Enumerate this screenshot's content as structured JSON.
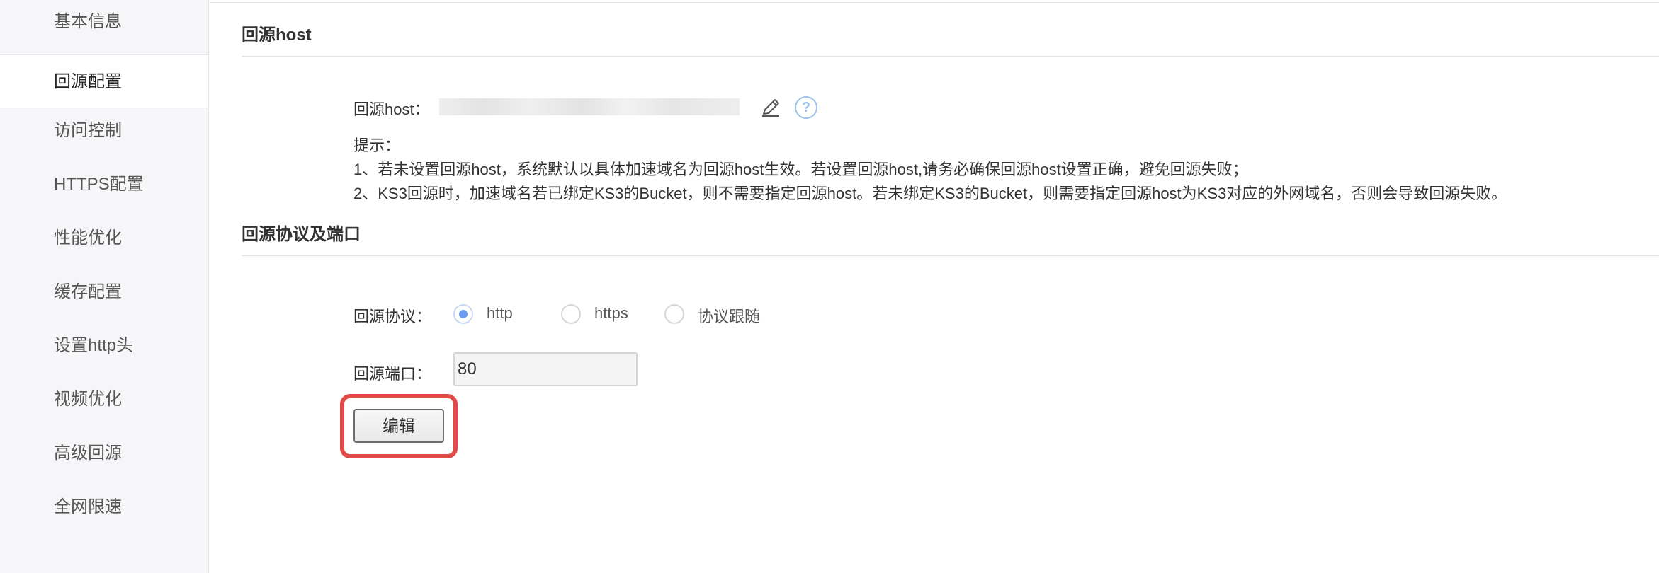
{
  "sidebar": {
    "items": [
      {
        "label": "基本信息"
      },
      {
        "label": "回源配置",
        "active": true
      },
      {
        "label": "访问控制"
      },
      {
        "label": "HTTPS配置"
      },
      {
        "label": "性能优化"
      },
      {
        "label": "缓存配置"
      },
      {
        "label": "设置http头"
      },
      {
        "label": "视频优化"
      },
      {
        "label": "高级回源"
      },
      {
        "label": "全网限速"
      }
    ]
  },
  "host_section": {
    "title": "回源host",
    "field_label": "回源host：",
    "edit_icon": "pencil-icon",
    "help_icon": "question-circle-icon",
    "help_glyph": "?",
    "tips_title": "提示：",
    "tip1": "1、若未设置回源host，系统默认以具体加速域名为回源host生效。若设置回源host,请务必确保回源host设置正确，避免回源失败；",
    "tip2": "2、KS3回源时，加速域名若已绑定KS3的Bucket，则不需要指定回源host。若未绑定KS3的Bucket，则需要指定回源host为KS3对应的外网域名，否则会导致回源失败。"
  },
  "protocol_section": {
    "title": "回源协议及端口",
    "protocol_label": "回源协议：",
    "options": [
      {
        "label": "http",
        "checked": true
      },
      {
        "label": "https",
        "checked": false
      },
      {
        "label": "协议跟随",
        "checked": false
      }
    ],
    "port_label": "回源端口：",
    "port_value": "80",
    "edit_button": "编辑"
  },
  "colors": {
    "accent": "#6a9cf0",
    "highlight": "#e24a48",
    "help": "#9ec2ea"
  }
}
